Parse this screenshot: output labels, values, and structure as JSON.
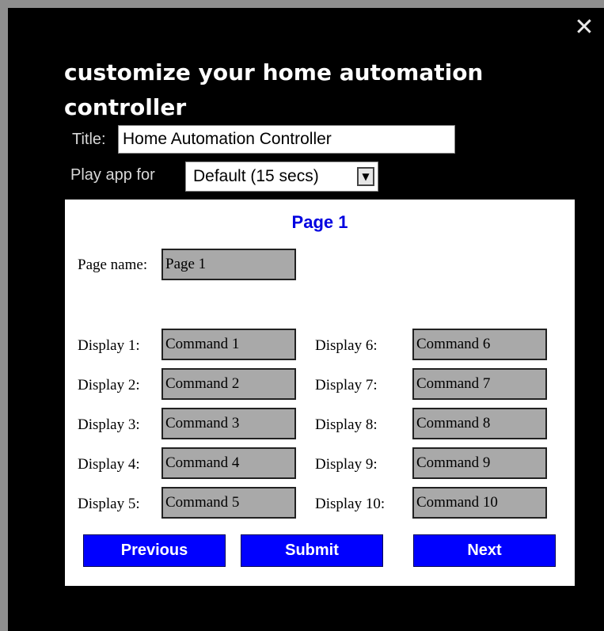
{
  "dialog": {
    "close_symbol": "✕",
    "heading": "customize your home automation controller"
  },
  "title_field": {
    "label": "Title:",
    "value": "Home Automation Controller"
  },
  "play_app": {
    "label": "Play app for",
    "selected": "Default (15 secs)",
    "arrow": "▼"
  },
  "panel": {
    "page_heading": "Page 1",
    "page_name_label": "Page name:",
    "page_name_value": "Page 1",
    "displays_left": [
      {
        "label": "Display 1:",
        "value": "Command 1"
      },
      {
        "label": "Display 2:",
        "value": "Command 2"
      },
      {
        "label": "Display 3:",
        "value": "Command 3"
      },
      {
        "label": "Display 4:",
        "value": "Command 4"
      },
      {
        "label": "Display 5:",
        "value": "Command 5"
      }
    ],
    "displays_right": [
      {
        "label": "Display 6:",
        "value": "Command 6"
      },
      {
        "label": "Display 7:",
        "value": "Command 7"
      },
      {
        "label": "Display 8:",
        "value": "Command 8"
      },
      {
        "label": "Display 9:",
        "value": "Command 9"
      },
      {
        "label": "Display 10:",
        "value": "Command 10"
      }
    ],
    "buttons": {
      "previous": "Previous",
      "submit": "Submit",
      "next": "Next"
    }
  },
  "colors": {
    "accent_blue": "#0000ff",
    "heading_blue": "#0000e0",
    "field_gray": "#a9a9a9"
  }
}
